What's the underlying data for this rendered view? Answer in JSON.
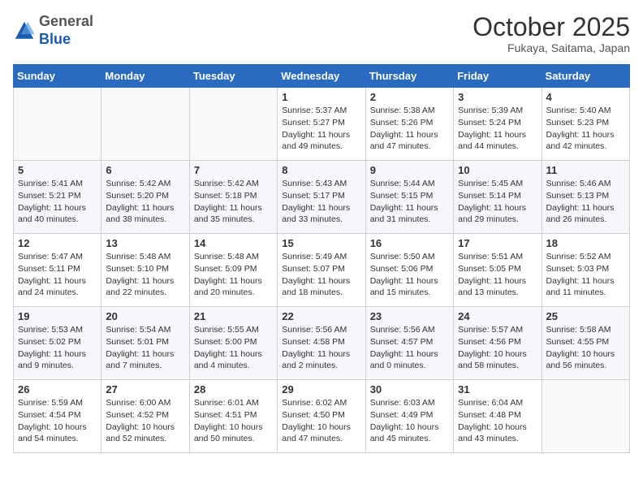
{
  "header": {
    "logo_general": "General",
    "logo_blue": "Blue",
    "month_title": "October 2025",
    "subtitle": "Fukaya, Saitama, Japan"
  },
  "weekdays": [
    "Sunday",
    "Monday",
    "Tuesday",
    "Wednesday",
    "Thursday",
    "Friday",
    "Saturday"
  ],
  "weeks": [
    [
      {
        "day": "",
        "sunrise": "",
        "sunset": "",
        "daylight": ""
      },
      {
        "day": "",
        "sunrise": "",
        "sunset": "",
        "daylight": ""
      },
      {
        "day": "",
        "sunrise": "",
        "sunset": "",
        "daylight": ""
      },
      {
        "day": "1",
        "sunrise": "Sunrise: 5:37 AM",
        "sunset": "Sunset: 5:27 PM",
        "daylight": "Daylight: 11 hours and 49 minutes."
      },
      {
        "day": "2",
        "sunrise": "Sunrise: 5:38 AM",
        "sunset": "Sunset: 5:26 PM",
        "daylight": "Daylight: 11 hours and 47 minutes."
      },
      {
        "day": "3",
        "sunrise": "Sunrise: 5:39 AM",
        "sunset": "Sunset: 5:24 PM",
        "daylight": "Daylight: 11 hours and 44 minutes."
      },
      {
        "day": "4",
        "sunrise": "Sunrise: 5:40 AM",
        "sunset": "Sunset: 5:23 PM",
        "daylight": "Daylight: 11 hours and 42 minutes."
      }
    ],
    [
      {
        "day": "5",
        "sunrise": "Sunrise: 5:41 AM",
        "sunset": "Sunset: 5:21 PM",
        "daylight": "Daylight: 11 hours and 40 minutes."
      },
      {
        "day": "6",
        "sunrise": "Sunrise: 5:42 AM",
        "sunset": "Sunset: 5:20 PM",
        "daylight": "Daylight: 11 hours and 38 minutes."
      },
      {
        "day": "7",
        "sunrise": "Sunrise: 5:42 AM",
        "sunset": "Sunset: 5:18 PM",
        "daylight": "Daylight: 11 hours and 35 minutes."
      },
      {
        "day": "8",
        "sunrise": "Sunrise: 5:43 AM",
        "sunset": "Sunset: 5:17 PM",
        "daylight": "Daylight: 11 hours and 33 minutes."
      },
      {
        "day": "9",
        "sunrise": "Sunrise: 5:44 AM",
        "sunset": "Sunset: 5:15 PM",
        "daylight": "Daylight: 11 hours and 31 minutes."
      },
      {
        "day": "10",
        "sunrise": "Sunrise: 5:45 AM",
        "sunset": "Sunset: 5:14 PM",
        "daylight": "Daylight: 11 hours and 29 minutes."
      },
      {
        "day": "11",
        "sunrise": "Sunrise: 5:46 AM",
        "sunset": "Sunset: 5:13 PM",
        "daylight": "Daylight: 11 hours and 26 minutes."
      }
    ],
    [
      {
        "day": "12",
        "sunrise": "Sunrise: 5:47 AM",
        "sunset": "Sunset: 5:11 PM",
        "daylight": "Daylight: 11 hours and 24 minutes."
      },
      {
        "day": "13",
        "sunrise": "Sunrise: 5:48 AM",
        "sunset": "Sunset: 5:10 PM",
        "daylight": "Daylight: 11 hours and 22 minutes."
      },
      {
        "day": "14",
        "sunrise": "Sunrise: 5:48 AM",
        "sunset": "Sunset: 5:09 PM",
        "daylight": "Daylight: 11 hours and 20 minutes."
      },
      {
        "day": "15",
        "sunrise": "Sunrise: 5:49 AM",
        "sunset": "Sunset: 5:07 PM",
        "daylight": "Daylight: 11 hours and 18 minutes."
      },
      {
        "day": "16",
        "sunrise": "Sunrise: 5:50 AM",
        "sunset": "Sunset: 5:06 PM",
        "daylight": "Daylight: 11 hours and 15 minutes."
      },
      {
        "day": "17",
        "sunrise": "Sunrise: 5:51 AM",
        "sunset": "Sunset: 5:05 PM",
        "daylight": "Daylight: 11 hours and 13 minutes."
      },
      {
        "day": "18",
        "sunrise": "Sunrise: 5:52 AM",
        "sunset": "Sunset: 5:03 PM",
        "daylight": "Daylight: 11 hours and 11 minutes."
      }
    ],
    [
      {
        "day": "19",
        "sunrise": "Sunrise: 5:53 AM",
        "sunset": "Sunset: 5:02 PM",
        "daylight": "Daylight: 11 hours and 9 minutes."
      },
      {
        "day": "20",
        "sunrise": "Sunrise: 5:54 AM",
        "sunset": "Sunset: 5:01 PM",
        "daylight": "Daylight: 11 hours and 7 minutes."
      },
      {
        "day": "21",
        "sunrise": "Sunrise: 5:55 AM",
        "sunset": "Sunset: 5:00 PM",
        "daylight": "Daylight: 11 hours and 4 minutes."
      },
      {
        "day": "22",
        "sunrise": "Sunrise: 5:56 AM",
        "sunset": "Sunset: 4:58 PM",
        "daylight": "Daylight: 11 hours and 2 minutes."
      },
      {
        "day": "23",
        "sunrise": "Sunrise: 5:56 AM",
        "sunset": "Sunset: 4:57 PM",
        "daylight": "Daylight: 11 hours and 0 minutes."
      },
      {
        "day": "24",
        "sunrise": "Sunrise: 5:57 AM",
        "sunset": "Sunset: 4:56 PM",
        "daylight": "Daylight: 10 hours and 58 minutes."
      },
      {
        "day": "25",
        "sunrise": "Sunrise: 5:58 AM",
        "sunset": "Sunset: 4:55 PM",
        "daylight": "Daylight: 10 hours and 56 minutes."
      }
    ],
    [
      {
        "day": "26",
        "sunrise": "Sunrise: 5:59 AM",
        "sunset": "Sunset: 4:54 PM",
        "daylight": "Daylight: 10 hours and 54 minutes."
      },
      {
        "day": "27",
        "sunrise": "Sunrise: 6:00 AM",
        "sunset": "Sunset: 4:52 PM",
        "daylight": "Daylight: 10 hours and 52 minutes."
      },
      {
        "day": "28",
        "sunrise": "Sunrise: 6:01 AM",
        "sunset": "Sunset: 4:51 PM",
        "daylight": "Daylight: 10 hours and 50 minutes."
      },
      {
        "day": "29",
        "sunrise": "Sunrise: 6:02 AM",
        "sunset": "Sunset: 4:50 PM",
        "daylight": "Daylight: 10 hours and 47 minutes."
      },
      {
        "day": "30",
        "sunrise": "Sunrise: 6:03 AM",
        "sunset": "Sunset: 4:49 PM",
        "daylight": "Daylight: 10 hours and 45 minutes."
      },
      {
        "day": "31",
        "sunrise": "Sunrise: 6:04 AM",
        "sunset": "Sunset: 4:48 PM",
        "daylight": "Daylight: 10 hours and 43 minutes."
      },
      {
        "day": "",
        "sunrise": "",
        "sunset": "",
        "daylight": ""
      }
    ]
  ]
}
